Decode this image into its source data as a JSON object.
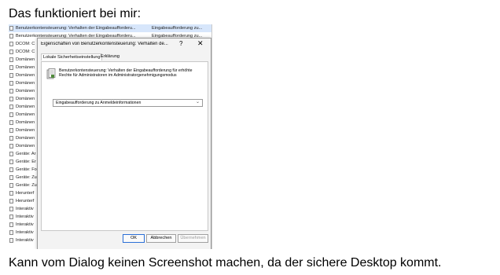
{
  "intro_text": "Das funktioniert bei mir:",
  "outro_text": "Kann vom Dialog keinen Screenshot machen, da der sichere Desktop kommt.",
  "screenshot": {
    "rows": [
      {
        "policy": "Benutzerkontensteuerung: Verhalten der Eingabeaufforderu...",
        "setting": "Eingabeaufforderung zu...",
        "selected": true
      },
      {
        "policy": "Benutzerkontensteuerung: Verhalten der Eingabeaufforderu...",
        "setting": "Eingabeaufforderung zu..."
      },
      {
        "policy": "DCOM: C",
        "setting": ""
      },
      {
        "policy": "DCOM: C",
        "setting": ""
      },
      {
        "policy": "Domänen",
        "setting": ""
      },
      {
        "policy": "Domänen",
        "setting": ""
      },
      {
        "policy": "Domänen",
        "setting": ""
      },
      {
        "policy": "Domänen",
        "setting": ""
      },
      {
        "policy": "Domänen",
        "setting": ""
      },
      {
        "policy": "Domänen",
        "setting": ""
      },
      {
        "policy": "Domänen",
        "setting": ""
      },
      {
        "policy": "Domänen",
        "setting": ""
      },
      {
        "policy": "Domänen",
        "setting": ""
      },
      {
        "policy": "Domänen",
        "setting": ""
      },
      {
        "policy": "Domänen",
        "setting": ""
      },
      {
        "policy": "Domänen",
        "setting": ""
      },
      {
        "policy": "Geräte: Ar",
        "setting": ""
      },
      {
        "policy": "Geräte: Er",
        "setting": ""
      },
      {
        "policy": "Geräte: Fo",
        "setting": ""
      },
      {
        "policy": "Geräte: Zu",
        "setting": ""
      },
      {
        "policy": "Geräte: Zu",
        "setting": ""
      },
      {
        "policy": "Herunterf",
        "setting": ""
      },
      {
        "policy": "Herunterf",
        "setting": ""
      },
      {
        "policy": "Interaktiv",
        "setting": ""
      },
      {
        "policy": "Interaktiv",
        "setting": ""
      },
      {
        "policy": "Interaktiv",
        "setting": ""
      },
      {
        "policy": "Interaktiv",
        "setting": ""
      },
      {
        "policy": "Interaktiv",
        "setting": ""
      }
    ],
    "dialog": {
      "title": "Eigenschaften von Benutzerkontensteuerung: Verhalten de...",
      "help_glyph": "?",
      "close_glyph": "✕",
      "tabs": [
        "Lokale Sicherheitseinstellung",
        "Erklärung"
      ],
      "description": "Benutzerkontensteuerung: Verhalten der Eingabeaufforderung für erhöhte Rechte für Administratoren im Administratorgenehmigungsmodus",
      "select_value": "Eingabeaufforderung zu Anmeldeinformationen",
      "chevron_glyph": "⌄",
      "buttons": {
        "ok": "OK",
        "cancel": "Abbrechen",
        "apply": "Übernehmen"
      }
    }
  }
}
